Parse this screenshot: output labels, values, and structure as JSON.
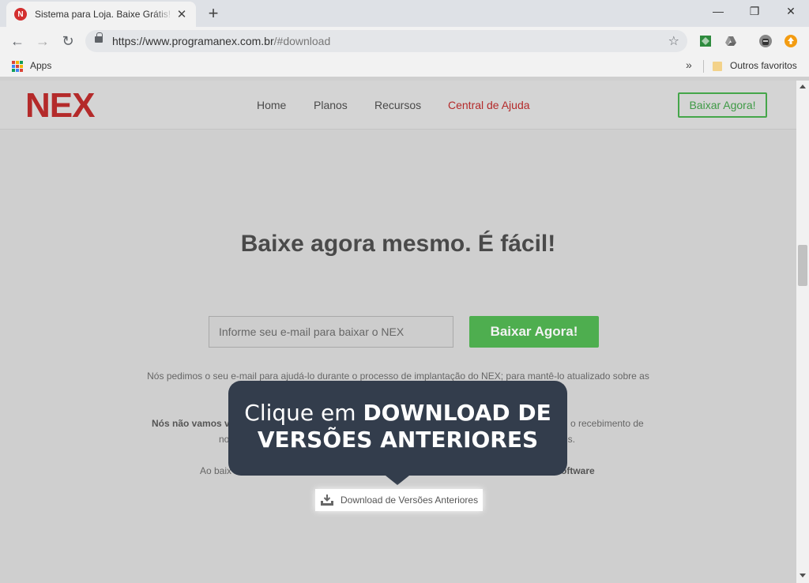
{
  "browser": {
    "tab": {
      "favicon_letter": "N",
      "title": "Sistema para Loja. Baixe Grátis! » ",
      "close_glyph": "✕"
    },
    "new_tab_glyph": "+",
    "window": {
      "minimize": "—",
      "restore": "❐",
      "close": "✕"
    },
    "nav": {
      "back": "←",
      "forward": "→",
      "reload": "↻"
    },
    "address": {
      "host": "https://www.programanex.com.br",
      "path": "/#download"
    },
    "bookmark_star": "☆",
    "bookmarks": {
      "apps_label": "Apps",
      "more": "»",
      "other_label": "Outros favoritos"
    }
  },
  "site": {
    "logo": "NEX",
    "nav": [
      "Home",
      "Planos",
      "Recursos",
      "Central de Ajuda"
    ],
    "header_cta": "Baixar Agora!",
    "headline": "Baixe agora mesmo. É fácil!",
    "email_placeholder": "Informe seu e-mail para baixar o NEX",
    "cta": "Baixar Agora!",
    "paragraph1": "Nós pedimos o seu e-mail para ajudá-lo durante o processo de implantação do NEX; para mantê-lo atualizado sobre as",
    "fragments": {
      "p2_left": "Nós não vamos v",
      "p2_right": "o recebimento de",
      "p3_left": "no",
      "p3_right": "es.",
      "p4_left": "Ao baix",
      "p4_right": "oftware"
    },
    "download_prev_label": "Download de Versões Anteriores"
  },
  "tooltip": {
    "line1_prefix": "Clique em ",
    "line1_bold": "DOWNLOAD DE",
    "line2_bold": "VERSÕES ANTERIORES"
  },
  "colors": {
    "brand_red": "#b42a2a",
    "cta_green": "#4eae4f",
    "tooltip_bg": "#333d4c"
  }
}
